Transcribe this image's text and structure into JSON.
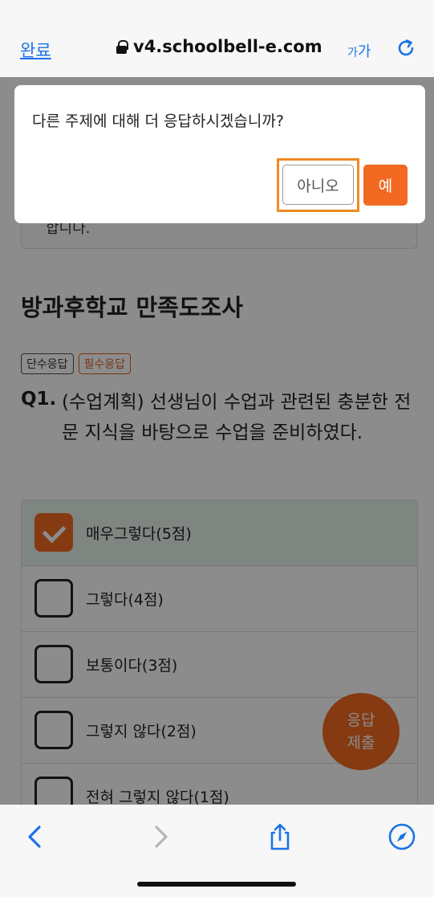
{
  "browser": {
    "done_label": "완료",
    "url": "v4.schoolbell-e.com",
    "text_size_small": "가",
    "text_size_large": "가",
    "accent_color": "#1a73e8"
  },
  "page": {
    "previous_card_text": "합니다.",
    "survey_title": "방과후학교 만족도조사",
    "tags": [
      "단수응답",
      "필수응답"
    ],
    "question_number": "Q1.",
    "question_text": "(수업계획) 선생님이 수업과 관련된 충분한 전문 지식을 바탕으로 수업을 준비하였다.",
    "options": [
      {
        "label": "매우그렇다(5점)",
        "checked": true
      },
      {
        "label": "그렇다(4점)",
        "checked": false
      },
      {
        "label": "보통이다(3점)",
        "checked": false
      },
      {
        "label": "그렇지 않다(2점)",
        "checked": false
      },
      {
        "label": "전혀 그렇지 않다(1점)",
        "checked": false
      }
    ],
    "submit_fab_line1": "응답",
    "submit_fab_line2": "제출",
    "brand_color": "#f26a21"
  },
  "dialog": {
    "message": "다른 주제에 대해 더 응답하시겠습니까?",
    "no_label": "아니오",
    "yes_label": "예"
  },
  "toolbar": {
    "icons": [
      "back-icon",
      "forward-icon",
      "share-icon",
      "compass-icon"
    ]
  }
}
